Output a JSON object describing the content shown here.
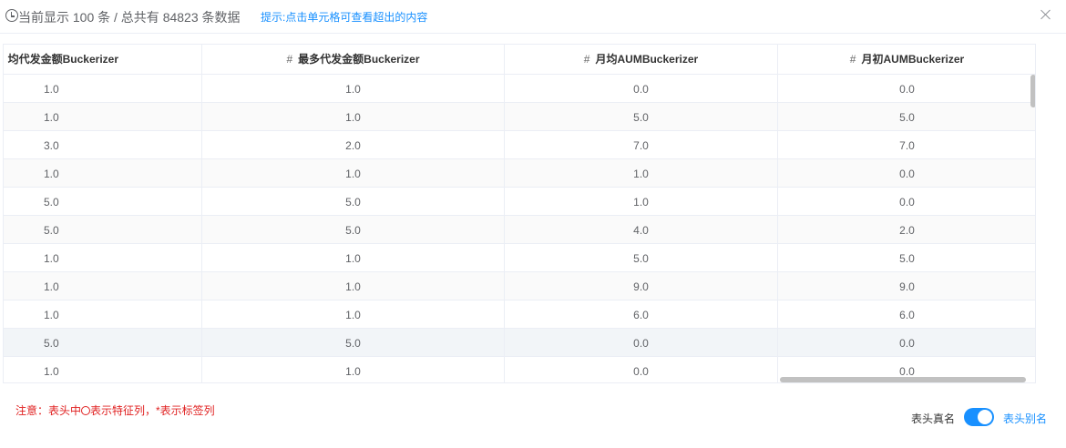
{
  "header": {
    "summary": "当前显示 100 条 / 总共有 84823 条数据",
    "hint": "提示:点击单元格可查看超出的内容"
  },
  "table": {
    "hash_symbol": "#",
    "columns": [
      {
        "label": "均代发金额Buckerizer",
        "hash": false
      },
      {
        "label": "最多代发金额Buckerizer",
        "hash": true
      },
      {
        "label": "月均AUMBuckerizer",
        "hash": true
      },
      {
        "label": "月初AUMBuckerizer",
        "hash": true
      }
    ],
    "rows": [
      [
        "1.0",
        "1.0",
        "0.0",
        "0.0"
      ],
      [
        "1.0",
        "1.0",
        "5.0",
        "5.0"
      ],
      [
        "3.0",
        "2.0",
        "7.0",
        "7.0"
      ],
      [
        "1.0",
        "1.0",
        "1.0",
        "0.0"
      ],
      [
        "5.0",
        "5.0",
        "1.0",
        "0.0"
      ],
      [
        "5.0",
        "5.0",
        "4.0",
        "2.0"
      ],
      [
        "1.0",
        "1.0",
        "5.0",
        "5.0"
      ],
      [
        "1.0",
        "1.0",
        "9.0",
        "9.0"
      ],
      [
        "1.0",
        "1.0",
        "6.0",
        "6.0"
      ],
      [
        "5.0",
        "5.0",
        "0.0",
        "0.0"
      ],
      [
        "1.0",
        "1.0",
        "0.0",
        "0.0"
      ]
    ]
  },
  "footer": {
    "note_prefix": "注意：表头中",
    "note_suffix": "表示特征列，*表示标签列",
    "label_real": "表头真名",
    "label_alias": "表头别名",
    "toggle_on": true
  },
  "colors": {
    "accent": "#1890ff",
    "warning_text": "#e02020",
    "border": "#ebeef5"
  }
}
